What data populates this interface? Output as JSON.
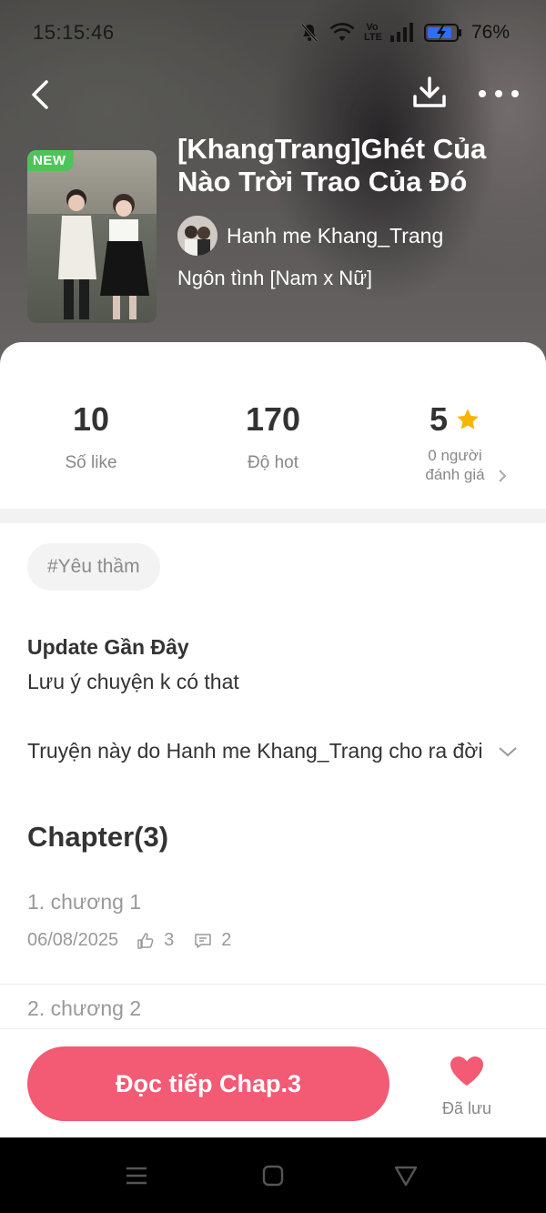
{
  "status_bar": {
    "time": "15:15:46",
    "battery": "76%",
    "network_label": "Vo LTE"
  },
  "book": {
    "badge": "NEW",
    "title": "[KhangTrang]Ghét Của Nào Trời Trao Của Đó",
    "author": "Hanh me Khang_Trang",
    "genre": "Ngôn tình [Nam x Nữ]"
  },
  "stats": {
    "likes_value": "10",
    "likes_label": "Số like",
    "hot_value": "170",
    "hot_label": "Độ hot",
    "rating_value": "5",
    "rating_sub_1": "0 người",
    "rating_sub_2": "đánh giá"
  },
  "tag": "#Yêu thầm",
  "update": {
    "title": "Update Gần Đây",
    "text": "Lưu ý chuyện k có that"
  },
  "description": "Truyện này do Hanh me Khang_Trang cho ra đời",
  "chapters": {
    "heading": "Chapter(3)",
    "items": [
      {
        "name": "1. chương 1",
        "date": "06/08/2025",
        "likes": "3",
        "comments": "2"
      },
      {
        "name": "2. chương 2"
      }
    ]
  },
  "bottom": {
    "read_label": "Đọc tiếp Chap.3",
    "save_label": "Đã lưu"
  },
  "colors": {
    "accent": "#f35a73",
    "badge": "#4fc35b",
    "star": "#f7b500"
  }
}
